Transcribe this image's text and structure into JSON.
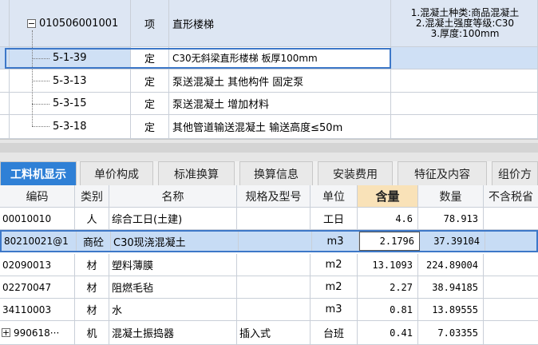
{
  "top_table": {
    "rows": [
      {
        "code": "010506001001",
        "type": "项",
        "name": "直形楼梯",
        "features": [
          "1.混凝土种类:商品混凝土",
          "2.混凝土强度等级:C30",
          "3.厚度:100mm"
        ]
      },
      {
        "code": "5-1-39",
        "type": "定",
        "name": "C30无斜梁直形楼梯 板厚100mm"
      },
      {
        "code": "5-3-13",
        "type": "定",
        "name": "泵送混凝土 其他构件 固定泵"
      },
      {
        "code": "5-3-15",
        "type": "定",
        "name": "泵送混凝土 增加材料"
      },
      {
        "code": "5-3-18",
        "type": "定",
        "name": "其他管道输送混凝土 输送高度≤50m"
      }
    ],
    "collapse_symbol": "−"
  },
  "tabs": [
    "工料机显示",
    "单价构成",
    "标准换算",
    "换算信息",
    "安装费用",
    "特征及内容",
    "组价方"
  ],
  "grid": {
    "headers": [
      "编码",
      "类别",
      "名称",
      "规格及型号",
      "单位",
      "含量",
      "数量",
      "不含税省"
    ],
    "rows": [
      {
        "code": "00010010",
        "cat": "人",
        "name": "综合工日(土建)",
        "spec": "",
        "unit": "工日",
        "qty_per": "4.6",
        "qty": "78.913",
        "price": ""
      },
      {
        "code": "80210021@1",
        "cat": "商砼",
        "name": "C30现浇混凝土",
        "spec": "",
        "unit": "m3",
        "qty_per": "2.1796",
        "qty": "37.39104",
        "price": ""
      },
      {
        "code": "02090013",
        "cat": "材",
        "name": "塑料薄膜",
        "spec": "",
        "unit": "m2",
        "qty_per": "13.1093",
        "qty": "224.89004",
        "price": ""
      },
      {
        "code": "02270047",
        "cat": "材",
        "name": "阻燃毛毡",
        "spec": "",
        "unit": "m2",
        "qty_per": "2.27",
        "qty": "38.94185",
        "price": ""
      },
      {
        "code": "34110003",
        "cat": "材",
        "name": "水",
        "spec": "",
        "unit": "m3",
        "qty_per": "0.81",
        "qty": "13.89555",
        "price": ""
      },
      {
        "code": "990618···",
        "cat": "机",
        "name": "混凝土振捣器",
        "spec": "插入式",
        "unit": "台班",
        "qty_per": "0.41",
        "qty": "7.03355",
        "price": ""
      }
    ],
    "expand_symbol": "+"
  },
  "colors": {
    "accent": "#2f80d6",
    "selection_border": "#3d78c8",
    "hot_header": "#f9e2b8",
    "row_highlight": "#dde6f3"
  }
}
